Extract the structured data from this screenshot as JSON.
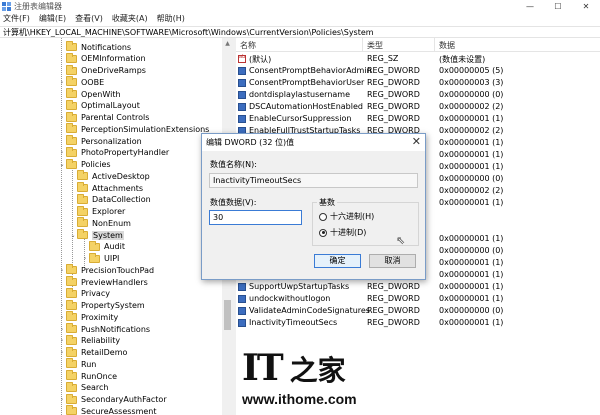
{
  "window": {
    "title": "注册表编辑器",
    "minimize": "—",
    "maximize": "☐",
    "close": "✕"
  },
  "menu": [
    "文件(F)",
    "编辑(E)",
    "查看(V)",
    "收藏夹(A)",
    "帮助(H)"
  ],
  "address": "计算机\\HKEY_LOCAL_MACHINE\\SOFTWARE\\Microsoft\\Windows\\CurrentVersion\\Policies\\System",
  "tree": [
    {
      "label": "Notifications",
      "level": 1,
      "expander": ""
    },
    {
      "label": "OEMInformation",
      "level": 1,
      "expander": ""
    },
    {
      "label": "OneDriveRamps",
      "level": 1,
      "expander": ""
    },
    {
      "label": "OOBE",
      "level": 1,
      "expander": "›"
    },
    {
      "label": "OpenWith",
      "level": 1,
      "expander": ""
    },
    {
      "label": "OptimalLayout",
      "level": 1,
      "expander": ""
    },
    {
      "label": "Parental Controls",
      "level": 1,
      "expander": "›"
    },
    {
      "label": "PerceptionSimulationExtensions",
      "level": 1,
      "expander": ""
    },
    {
      "label": "Personalization",
      "level": 1,
      "expander": ""
    },
    {
      "label": "PhotoPropertyHandler",
      "level": 1,
      "expander": "›"
    },
    {
      "label": "Policies",
      "level": 1,
      "expander": "⌄"
    },
    {
      "label": "ActiveDesktop",
      "level": 2,
      "expander": ""
    },
    {
      "label": "Attachments",
      "level": 2,
      "expander": ""
    },
    {
      "label": "DataCollection",
      "level": 2,
      "expander": ""
    },
    {
      "label": "Explorer",
      "level": 2,
      "expander": ""
    },
    {
      "label": "NonEnum",
      "level": 2,
      "expander": ""
    },
    {
      "label": "System",
      "level": 2,
      "expander": "⌄",
      "selected": true
    },
    {
      "label": "Audit",
      "level": 3,
      "expander": ""
    },
    {
      "label": "UIPI",
      "level": 3,
      "expander": "›"
    },
    {
      "label": "PrecisionTouchPad",
      "level": 1,
      "expander": "›"
    },
    {
      "label": "PreviewHandlers",
      "level": 1,
      "expander": ""
    },
    {
      "label": "Privacy",
      "level": 1,
      "expander": ""
    },
    {
      "label": "PropertySystem",
      "level": 1,
      "expander": "›"
    },
    {
      "label": "Proximity",
      "level": 1,
      "expander": "›"
    },
    {
      "label": "PushNotifications",
      "level": 1,
      "expander": "›"
    },
    {
      "label": "Reliability",
      "level": 1,
      "expander": "›"
    },
    {
      "label": "RetailDemo",
      "level": 1,
      "expander": "›"
    },
    {
      "label": "Run",
      "level": 1,
      "expander": ""
    },
    {
      "label": "RunOnce",
      "level": 1,
      "expander": ""
    },
    {
      "label": "Search",
      "level": 1,
      "expander": ""
    },
    {
      "label": "SecondaryAuthFactor",
      "level": 1,
      "expander": "›"
    },
    {
      "label": "SecureAssessment",
      "level": 1,
      "expander": ""
    }
  ],
  "list": {
    "headers": {
      "name": "名称",
      "type": "类型",
      "data": "数据"
    },
    "rows": [
      {
        "name": "(默认)",
        "type": "REG_SZ",
        "data": "(数值未设置)",
        "kind": "sz"
      },
      {
        "name": "ConsentPromptBehaviorAdmin",
        "type": "REG_DWORD",
        "data": "0x00000005 (5)",
        "kind": "dword"
      },
      {
        "name": "ConsentPromptBehaviorUser",
        "type": "REG_DWORD",
        "data": "0x00000003 (3)",
        "kind": "dword"
      },
      {
        "name": "dontdisplaylastusername",
        "type": "REG_DWORD",
        "data": "0x00000000 (0)",
        "kind": "dword"
      },
      {
        "name": "DSCAutomationHostEnabled",
        "type": "REG_DWORD",
        "data": "0x00000002 (2)",
        "kind": "dword"
      },
      {
        "name": "EnableCursorSuppression",
        "type": "REG_DWORD",
        "data": "0x00000001 (1)",
        "kind": "dword"
      },
      {
        "name": "EnableFullTrustStartupTasks",
        "type": "REG_DWORD",
        "data": "0x00000002 (2)",
        "kind": "dword"
      },
      {
        "name": "",
        "type": "",
        "data": "0x00000001 (1)",
        "kind": "dword"
      },
      {
        "name": "",
        "type": "",
        "data": "0x00000001 (1)",
        "kind": "dword"
      },
      {
        "name": "",
        "type": "",
        "data": "0x00000001 (1)",
        "kind": "dword"
      },
      {
        "name": "",
        "type": "",
        "data": "0x00000000 (0)",
        "kind": "dword"
      },
      {
        "name": "",
        "type": "",
        "data": "0x00000002 (2)",
        "kind": "dword"
      },
      {
        "name": "",
        "type": "",
        "data": "0x00000001 (1)",
        "kind": "dword"
      },
      {
        "name": "",
        "type": "",
        "data": "",
        "kind": "none"
      },
      {
        "name": "",
        "type": "",
        "data": "",
        "kind": "none"
      },
      {
        "name": "",
        "type": "",
        "data": "0x00000001 (1)",
        "kind": "dword"
      },
      {
        "name": "",
        "type": "",
        "data": "0x00000000 (0)",
        "kind": "dword"
      },
      {
        "name": "",
        "type": "",
        "data": "0x00000001 (1)",
        "kind": "dword"
      },
      {
        "name": "SupportFullTrustStartupTasks",
        "type": "REG_DWORD",
        "data": "0x00000001 (1)",
        "kind": "dword"
      },
      {
        "name": "SupportUwpStartupTasks",
        "type": "REG_DWORD",
        "data": "0x00000001 (1)",
        "kind": "dword"
      },
      {
        "name": "undockwithoutlogon",
        "type": "REG_DWORD",
        "data": "0x00000001 (1)",
        "kind": "dword"
      },
      {
        "name": "ValidateAdminCodeSignatures",
        "type": "REG_DWORD",
        "data": "0x00000000 (0)",
        "kind": "dword"
      },
      {
        "name": "InactivityTimeoutSecs",
        "type": "REG_DWORD",
        "data": "0x00000001 (1)",
        "kind": "dword"
      }
    ]
  },
  "dialog": {
    "title": "编辑 DWORD (32 位)值",
    "close": "✕",
    "name_label": "数值名称(N):",
    "name_value": "InactivityTimeoutSecs",
    "data_label": "数值数据(V):",
    "data_value": "30",
    "base_label": "基数",
    "hex_label": "十六进制(H)",
    "dec_label": "十进制(D)",
    "base_selected": "decimal",
    "ok": "确定",
    "cancel": "取消"
  },
  "watermark": {
    "logo_latin": "IT",
    "logo_cn": "之家",
    "url": "www.ithome.com"
  }
}
